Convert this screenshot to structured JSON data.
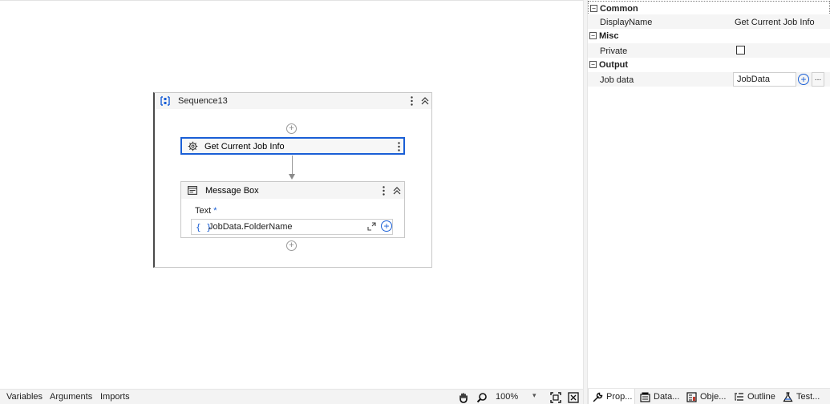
{
  "designer": {
    "sequence": {
      "title": "Sequence13",
      "icon": "sequence-icon"
    },
    "activities": {
      "get_job": {
        "title": "Get Current Job Info",
        "icon": "gear-icon"
      },
      "message_box": {
        "title": "Message Box",
        "icon": "message-box-icon",
        "text_label": "Text",
        "required_marker": "*",
        "expr_icon": "{ }",
        "text_value": "JobData.FolderName"
      }
    },
    "bottom_bar": {
      "tabs": [
        "Variables",
        "Arguments",
        "Imports"
      ],
      "zoom": "100%",
      "tools": [
        "hand-icon",
        "search-icon",
        "fit-to-screen-icon",
        "overview-icon"
      ]
    }
  },
  "properties": {
    "categories": {
      "common": {
        "label": "Common",
        "toggle": "−"
      },
      "misc": {
        "label": "Misc",
        "toggle": "−"
      },
      "output": {
        "label": "Output",
        "toggle": "−"
      }
    },
    "rows": {
      "display_name": {
        "name": "DisplayName",
        "value": "Get Current Job Info"
      },
      "private": {
        "name": "Private",
        "checked": false
      },
      "job_data": {
        "name": "Job data",
        "value": "JobData",
        "more": "..."
      }
    },
    "tabs": [
      {
        "label": "Prop...",
        "icon": "wrench-icon"
      },
      {
        "label": "Data...",
        "icon": "data-manager-icon"
      },
      {
        "label": "Obje...",
        "icon": "object-repository-icon"
      },
      {
        "label": "Outline",
        "icon": "outline-icon"
      },
      {
        "label": "Test...",
        "icon": "test-explorer-icon"
      }
    ]
  },
  "colors": {
    "accent": "#1a5fd6",
    "panel_bg": "#f3f3f3",
    "row_bg": "#f5f5f5"
  }
}
